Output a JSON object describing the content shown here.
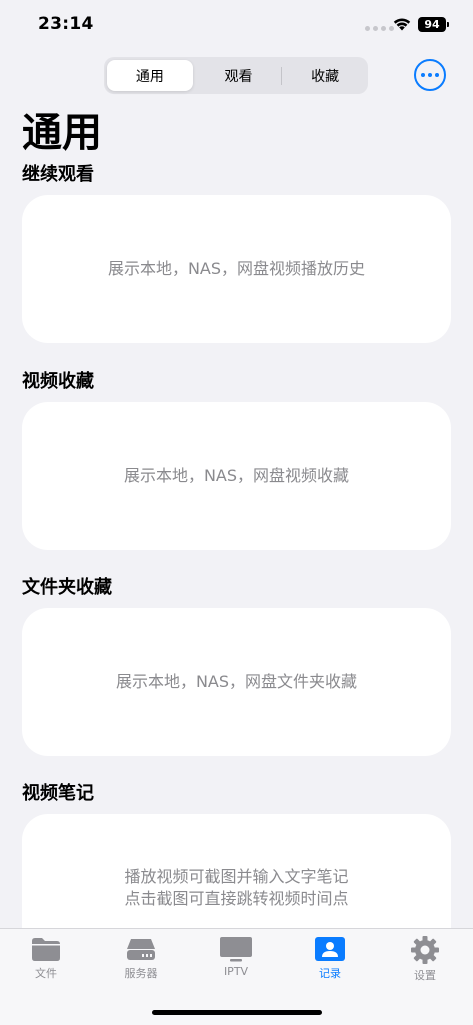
{
  "status_bar": {
    "time": "23:14",
    "battery": "94"
  },
  "segmented_control": {
    "tabs": [
      "通用",
      "观看",
      "收藏"
    ],
    "selected": "通用"
  },
  "page_title": "通用",
  "sections": [
    {
      "title": "继续观看",
      "message": "展示本地，NAS，网盘视频播放历史"
    },
    {
      "title": "视频收藏",
      "message": "展示本地，NAS，网盘视频收藏"
    },
    {
      "title": "文件夹收藏",
      "message": "展示本地，NAS，网盘文件夹收藏"
    },
    {
      "title": "视频笔记",
      "message": "播放视频可截图并输入文字笔记\n点击截图可直接跳转视频时间点"
    }
  ],
  "tab_bar": {
    "items": [
      {
        "label": "文件",
        "icon": "folder-icon"
      },
      {
        "label": "服务器",
        "icon": "server-icon"
      },
      {
        "label": "IPTV",
        "icon": "tv-icon"
      },
      {
        "label": "记录",
        "icon": "contact-card-icon"
      },
      {
        "label": "设置",
        "icon": "gear-icon"
      }
    ],
    "active": "记录"
  },
  "colors": {
    "accent": "#0a7cff",
    "background": "#f2f2f6",
    "card": "#ffffff",
    "muted_text": "#8a8a8e"
  }
}
